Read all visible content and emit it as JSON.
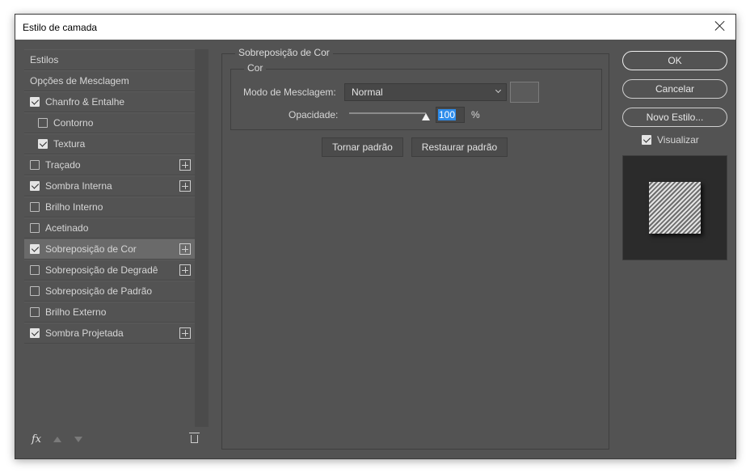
{
  "window": {
    "title": "Estilo de camada"
  },
  "styles_list": {
    "items": [
      {
        "label": "Estilos",
        "checkbox": false,
        "checked": false,
        "plus": false,
        "indent": false,
        "selected": false
      },
      {
        "label": "Opções de Mesclagem",
        "checkbox": false,
        "checked": false,
        "plus": false,
        "indent": false,
        "selected": false
      },
      {
        "label": "Chanfro & Entalhe",
        "checkbox": true,
        "checked": true,
        "plus": false,
        "indent": false,
        "selected": false
      },
      {
        "label": "Contorno",
        "checkbox": true,
        "checked": false,
        "plus": false,
        "indent": true,
        "selected": false
      },
      {
        "label": "Textura",
        "checkbox": true,
        "checked": true,
        "plus": false,
        "indent": true,
        "selected": false
      },
      {
        "label": "Traçado",
        "checkbox": true,
        "checked": false,
        "plus": true,
        "indent": false,
        "selected": false
      },
      {
        "label": "Sombra Interna",
        "checkbox": true,
        "checked": true,
        "plus": true,
        "indent": false,
        "selected": false
      },
      {
        "label": "Brilho Interno",
        "checkbox": true,
        "checked": false,
        "plus": false,
        "indent": false,
        "selected": false
      },
      {
        "label": "Acetinado",
        "checkbox": true,
        "checked": false,
        "plus": false,
        "indent": false,
        "selected": false
      },
      {
        "label": "Sobreposição de Cor",
        "checkbox": true,
        "checked": true,
        "plus": true,
        "indent": false,
        "selected": true
      },
      {
        "label": "Sobreposição de Degradê",
        "checkbox": true,
        "checked": false,
        "plus": true,
        "indent": false,
        "selected": false
      },
      {
        "label": "Sobreposição de Padrão",
        "checkbox": true,
        "checked": false,
        "plus": false,
        "indent": false,
        "selected": false
      },
      {
        "label": "Brilho Externo",
        "checkbox": true,
        "checked": false,
        "plus": false,
        "indent": false,
        "selected": false
      },
      {
        "label": "Sombra Projetada",
        "checkbox": true,
        "checked": true,
        "plus": true,
        "indent": false,
        "selected": false
      }
    ],
    "footer": {
      "fx_label": "fx",
      "icons": [
        "fx-icon",
        "move-up-icon",
        "move-down-icon",
        "trash-icon"
      ]
    }
  },
  "panel": {
    "group_title": "Sobreposição de Cor",
    "subgroup_title": "Cor",
    "blend_mode_label": "Modo de Mesclagem:",
    "blend_mode_value": "Normal",
    "opacity_label": "Opacidade:",
    "opacity_value": "100",
    "opacity_fraction": 1.0,
    "opacity_unit": "%",
    "make_default_label": "Tornar padrão",
    "reset_default_label": "Restaurar padrão",
    "swatch_color": "#5b5b5b"
  },
  "actions": {
    "ok_label": "OK",
    "cancel_label": "Cancelar",
    "new_style_label": "Novo Estilo...",
    "preview_label": "Visualizar",
    "preview_checked": true
  },
  "colors": {
    "dialog_bg": "#535353",
    "selected_row": "#6a6a6a",
    "text_highlight": "#2d8ceb"
  }
}
